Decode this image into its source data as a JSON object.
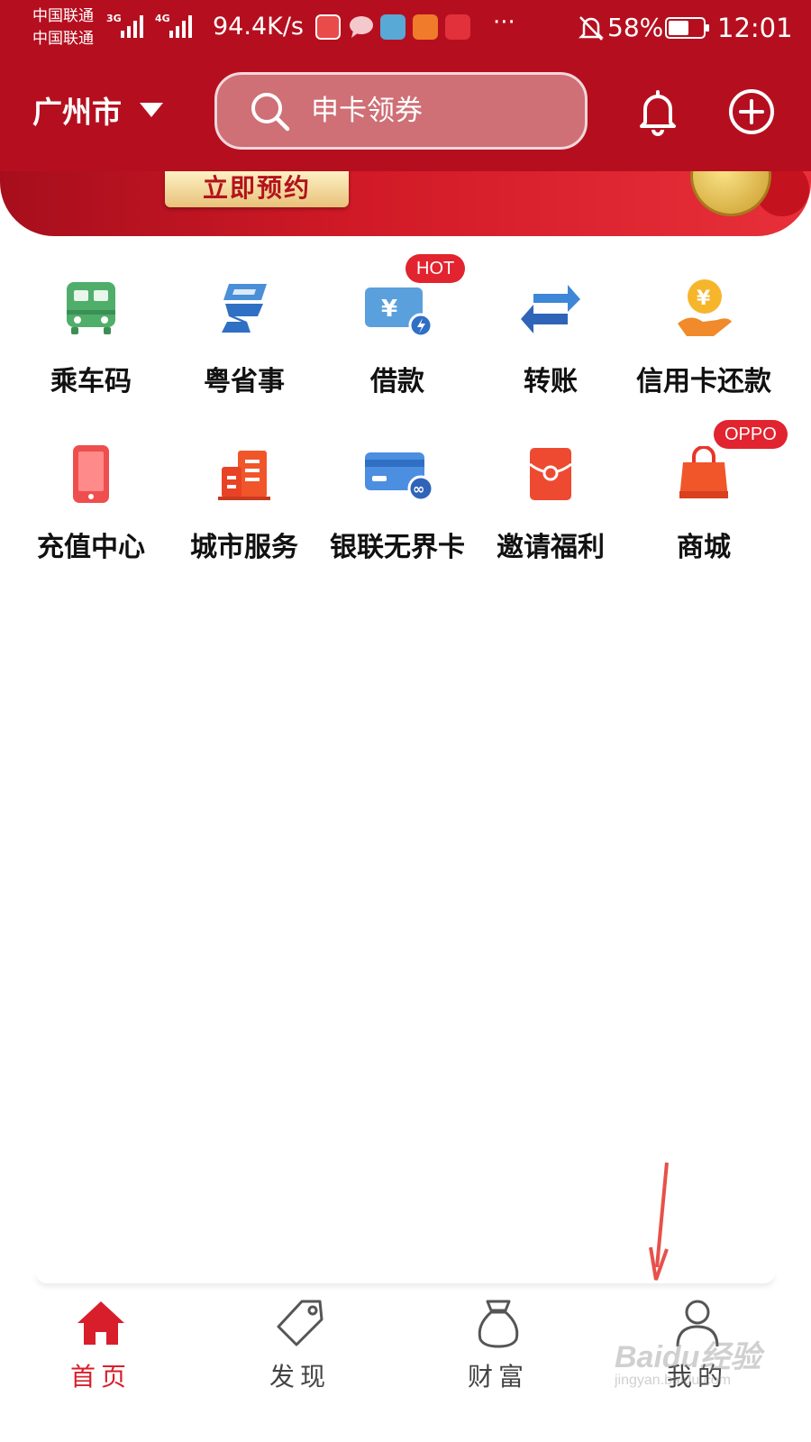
{
  "status_bar": {
    "carrier_top": "中国联通",
    "carrier_bottom": "中国联通",
    "network_1": "3G",
    "network_2": "4G",
    "speed": "94.4K/s",
    "more": "···",
    "battery": "58%",
    "time": "12:01"
  },
  "header": {
    "city": "广州市",
    "search_placeholder": "申卡领券"
  },
  "banner": {
    "button_label": "立即预约"
  },
  "services": [
    {
      "label": "乘车码"
    },
    {
      "label": "粤省事"
    },
    {
      "label": "借款",
      "badge": "HOT"
    },
    {
      "label": "转账"
    },
    {
      "label": "信用卡还款"
    },
    {
      "label": "充值中心"
    },
    {
      "label": "城市服务"
    },
    {
      "label": "银联无界卡"
    },
    {
      "label": "邀请福利"
    },
    {
      "label": "商城",
      "badge": "OPPO"
    }
  ],
  "nav": {
    "items": [
      {
        "label": "首页"
      },
      {
        "label": "发现"
      },
      {
        "label": "财富"
      },
      {
        "label": "我的"
      }
    ]
  },
  "colors": {
    "header_red": "#b50f1f",
    "accent_red": "#d81e2b",
    "badge_red": "#e1242f"
  },
  "watermark": {
    "big": "Baidu经验",
    "small": "jingyan.baidu.com"
  }
}
